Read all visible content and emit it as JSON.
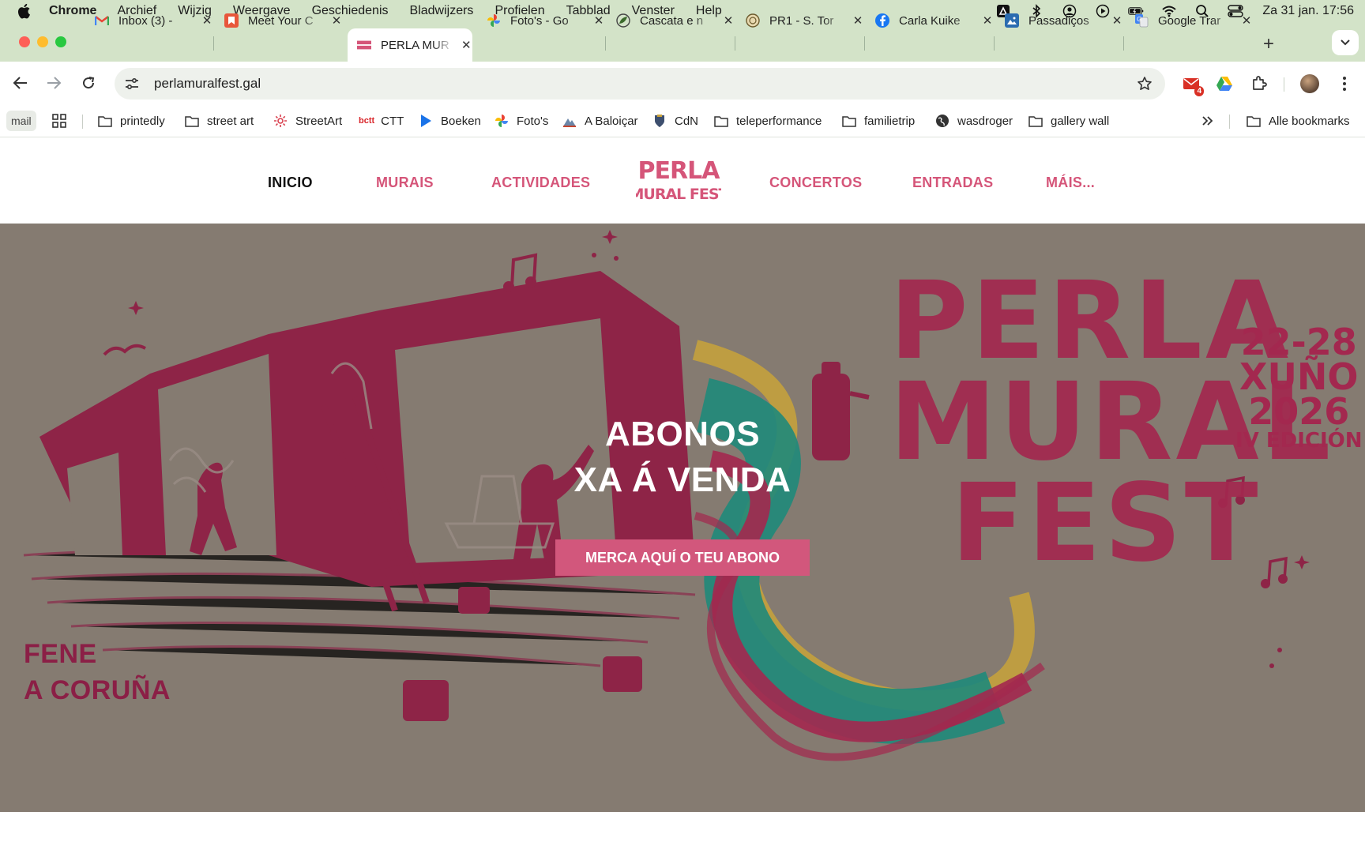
{
  "menubar": {
    "app": "Chrome",
    "items": [
      "Archief",
      "Wijzig",
      "Weergave",
      "Geschiedenis",
      "Bladwijzers",
      "Profielen",
      "Tabblad",
      "Venster",
      "Help"
    ],
    "clock": "Za 31 jan.  17:56"
  },
  "tabs": [
    {
      "title": "Inbox (3) - ",
      "icon": "gmail-icon"
    },
    {
      "title": "Meet Your C",
      "icon": "bookmark-icon"
    },
    {
      "title": "PERLA MUR",
      "icon": "perla-icon",
      "active": true
    },
    {
      "title": "Foto's - Go",
      "icon": "photos-icon"
    },
    {
      "title": "Cascata e n",
      "icon": "leaf-icon"
    },
    {
      "title": "PR1 - S. Tor",
      "icon": "seal-icon"
    },
    {
      "title": "Carla Kuike",
      "icon": "facebook-icon"
    },
    {
      "title": "Passadiços",
      "icon": "image-icon"
    },
    {
      "title": "Google Trar",
      "icon": "translate-icon"
    }
  ],
  "toolbar": {
    "url": "perlamuralfest.gal",
    "ext_badge": "4"
  },
  "bookmarks": {
    "mail": "mail",
    "items": [
      "printedly",
      "street art",
      "StreetArt",
      "CTT",
      "Boeken",
      "Foto's",
      "A Baloiçar",
      "CdN",
      "teleperformance",
      "familietrip",
      "wasdroger",
      "gallery wall"
    ],
    "ctt_prefix": "bctt",
    "all": "Alle bookmarks"
  },
  "site": {
    "nav": {
      "inicio": "INICIO",
      "murais": "MURAIS",
      "actividades": "ACTIVIDADES",
      "concertos": "CONCERTOS",
      "entradas": "ENTRADAS",
      "mais": "MÁIS..."
    },
    "logo": {
      "line1": "PERLA",
      "line2": "MURAL FEST"
    },
    "hero": {
      "title_line1": "ABONOS",
      "title_line2": "XA Á VENDA",
      "cta": "MERCA AQUÍ O TEU ABONO",
      "location_line1": "FENE",
      "location_line2": "A CORUÑA",
      "fest_line1": "PERLA",
      "fest_line2": "MURAL",
      "fest_line3": "FEST",
      "dates_line1": "22-28",
      "dates_line2": "XUÑO",
      "dates_line3": "2026",
      "edition": "IV EDICIÓN"
    }
  },
  "colors": {
    "chrome_frame": "#d3e3c8",
    "brand_pink": "#d55579",
    "hero_bg": "#857b71",
    "mural_red": "#a3284f",
    "teal": "#1f8a7a"
  }
}
